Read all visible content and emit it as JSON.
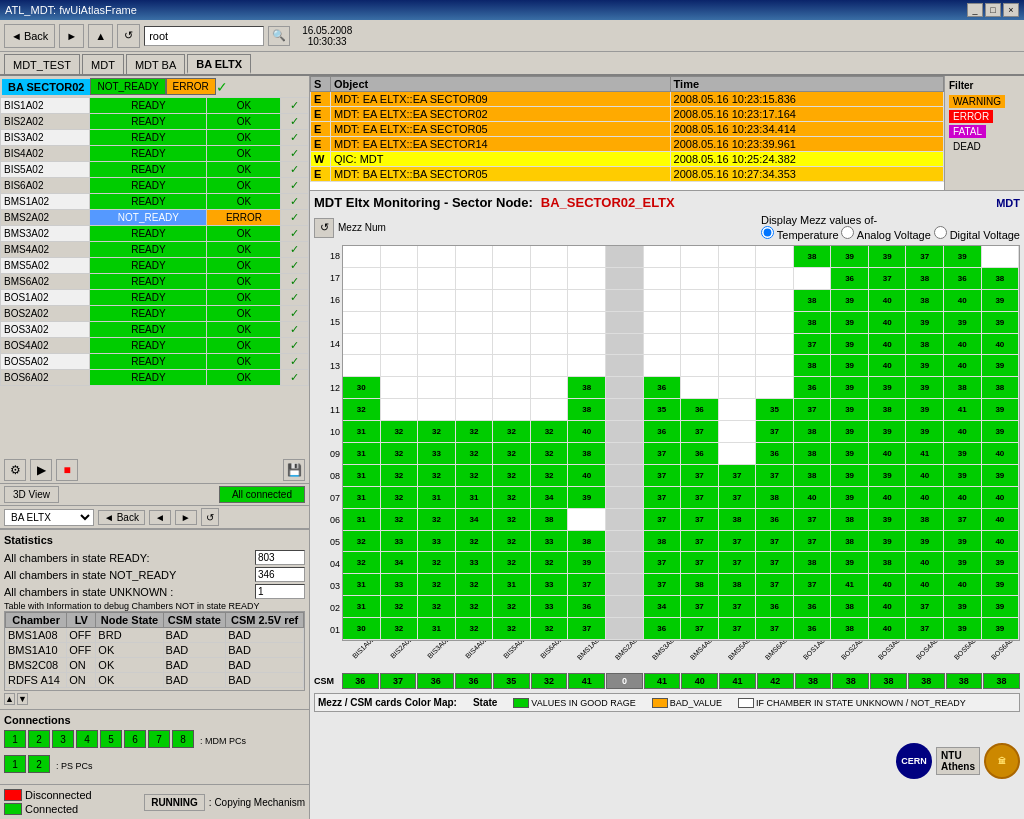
{
  "window": {
    "title": "ATL_MDT: fwUiAtlasFrame",
    "controls": [
      "_",
      "□",
      "×"
    ]
  },
  "toolbar": {
    "back_label": "Back",
    "address": "root",
    "datetime": "16.05.2008\n10:30:33"
  },
  "tabs": [
    {
      "id": "mdt_test",
      "label": "MDT_TEST"
    },
    {
      "id": "mdt",
      "label": "MDT"
    },
    {
      "id": "mdt_ba",
      "label": "MDT BA"
    },
    {
      "id": "ba_eltx",
      "label": "BA ELTX",
      "active": true
    }
  ],
  "sector_header": {
    "name": "BA SECTOR02",
    "status": "NOT_READY",
    "error": "ERROR"
  },
  "chambers": [
    {
      "name": "BIS1A02",
      "ready": "READY",
      "ok": "OK"
    },
    {
      "name": "BIS2A02",
      "ready": "READY",
      "ok": "OK"
    },
    {
      "name": "BIS3A02",
      "ready": "READY",
      "ok": "OK"
    },
    {
      "name": "BIS4A02",
      "ready": "READY",
      "ok": "OK"
    },
    {
      "name": "BIS5A02",
      "ready": "READY",
      "ok": "OK"
    },
    {
      "name": "BIS6A02",
      "ready": "READY",
      "ok": "OK"
    },
    {
      "name": "BMS1A02",
      "ready": "READY",
      "ok": "OK"
    },
    {
      "name": "BMS2A02",
      "ready": "NOT_READY",
      "ok": "ERROR",
      "highlight": true
    },
    {
      "name": "BMS3A02",
      "ready": "READY",
      "ok": "OK"
    },
    {
      "name": "BMS4A02",
      "ready": "READY",
      "ok": "OK"
    },
    {
      "name": "BMS5A02",
      "ready": "READY",
      "ok": "OK"
    },
    {
      "name": "BMS6A02",
      "ready": "READY",
      "ok": "OK"
    },
    {
      "name": "BOS1A02",
      "ready": "READY",
      "ok": "OK"
    },
    {
      "name": "BOS2A02",
      "ready": "READY",
      "ok": "OK"
    },
    {
      "name": "BOS3A02",
      "ready": "READY",
      "ok": "OK"
    },
    {
      "name": "BOS4A02",
      "ready": "READY",
      "ok": "OK"
    },
    {
      "name": "BOS5A02",
      "ready": "READY",
      "ok": "OK"
    },
    {
      "name": "BOS6A02",
      "ready": "READY",
      "ok": "OK"
    }
  ],
  "nav_panel": {
    "dropdown": "BA ELTX",
    "back_label": "Back"
  },
  "stats": {
    "title": "Statistics",
    "ready_label": "All chambers in state READY:",
    "ready_value": "803",
    "not_ready_label": "All chambers in state NOT_READY",
    "not_ready_value": "346",
    "unknown_label": "All chambers in state UNKNOWN :",
    "unknown_value": "1",
    "debug_title": "Table with Information to debug Chambers NOT in state READY"
  },
  "debug_table": {
    "headers": [
      "Chamber",
      "LV",
      "Node State",
      "CSM state",
      "CSM 2.5V ref"
    ],
    "rows": [
      {
        "chamber": "BMS1A08",
        "lv": "OFF",
        "node": "BRD",
        "csm": "BAD",
        "ref": "BAD"
      },
      {
        "chamber": "BMS1A10",
        "lv": "OFF",
        "node": "OK",
        "csm": "BAD",
        "ref": "BAD"
      },
      {
        "chamber": "BMS2C08",
        "lv": "ON",
        "node": "OK",
        "csm": "BAD",
        "ref": "BAD"
      },
      {
        "chamber": "RDFS A14",
        "lv": "ON",
        "node": "OK",
        "csm": "BAD",
        "ref": "BAD"
      }
    ]
  },
  "connections": {
    "title": "Connections",
    "mdm_buttons": [
      "1",
      "2",
      "3",
      "4",
      "5",
      "6",
      "7",
      "8"
    ],
    "mdm_label": ": MDM PCs",
    "ps_buttons": [
      "1",
      "2"
    ],
    "ps_label": ": PS PCs"
  },
  "color_map": {
    "running_label": "RUNNING",
    "copying_label": ": Copying Mechanism",
    "disconnected_label": "Disconnected",
    "connected_label": "Connected"
  },
  "alerts": {
    "headers": [
      "S",
      "Object",
      "Time"
    ],
    "rows": [
      {
        "s": "E",
        "obj": "MDT: EA ELTX::EA SECTOR09",
        "time": "2008.05.16 10:23:15.836",
        "type": "e"
      },
      {
        "s": "E",
        "obj": "MDT: EA ELTX::EA SECTOR02",
        "time": "2008.05.16 10:23:17.164",
        "type": "e"
      },
      {
        "s": "E",
        "obj": "MDT: EA ELTX::EA SECTOR05",
        "time": "2008.05.16 10:23:34.414",
        "type": "e"
      },
      {
        "s": "E",
        "obj": "MDT: EA ELTX::EA SECTOR14",
        "time": "2008.05.16 10:23:39.961",
        "type": "e"
      },
      {
        "s": "W",
        "obj": "QIC: MDT",
        "time": "2008.05.16 10:25:24.382",
        "type": "wv"
      },
      {
        "s": "E",
        "obj": "MDT: BA ELTX::BA SECTOR05",
        "time": "2008.05.16 10:27:34.353",
        "type": "e",
        "selected": true
      }
    ]
  },
  "filter": {
    "title": "Filter",
    "items": [
      "WARNING",
      "ERROR",
      "FATAL",
      "DEAD"
    ]
  },
  "mdt_monitor": {
    "title": "MDT Eltx Monitoring  - Sector Node:",
    "sector": "BA_SECTOR02_ELTX",
    "mdt_tag": "MDT",
    "display_label": "Display Mezz values of-",
    "options": [
      "Temperature",
      "Analog Voltage",
      "Digital Voltage"
    ],
    "mezz_label": "Mezz Num",
    "y_labels": [
      "18",
      "17",
      "16",
      "15",
      "14",
      "13",
      "12",
      "11",
      "10",
      "09",
      "08",
      "07",
      "06",
      "05",
      "04",
      "03",
      "02",
      "01"
    ],
    "x_labels": [
      "BIS1A02",
      "BIS2A02",
      "BIS3A02",
      "BIS4A02",
      "BIS5A02",
      "BIS6A02",
      "BMS1A02",
      "BMS2A02",
      "BMS3A02",
      "BMS4A02",
      "BMS5A02",
      "BMS6A02",
      "BOS1A02",
      "BOS2A02",
      "BOS3A02",
      "BOS4A02",
      "BOS5A02",
      "BOS6A02"
    ],
    "csm_label": "CSM",
    "csm_values": [
      "36",
      "37",
      "36",
      "36",
      "35",
      "32",
      "41",
      "0",
      "41",
      "40",
      "41",
      "42",
      "38",
      "38",
      "38",
      "38",
      "38",
      "38"
    ]
  },
  "legend": {
    "title": "Mezz / CSM cards Color Map:",
    "state_label": "State",
    "items": [
      {
        "color": "#00cc00",
        "label": "VALUES IN GOOD RAGE"
      },
      {
        "color": "orange",
        "label": "BAD_VALUE"
      },
      {
        "color": "white",
        "label": "IF CHAMBER IN STATE UNKNOWN / NOT_READY"
      }
    ]
  }
}
